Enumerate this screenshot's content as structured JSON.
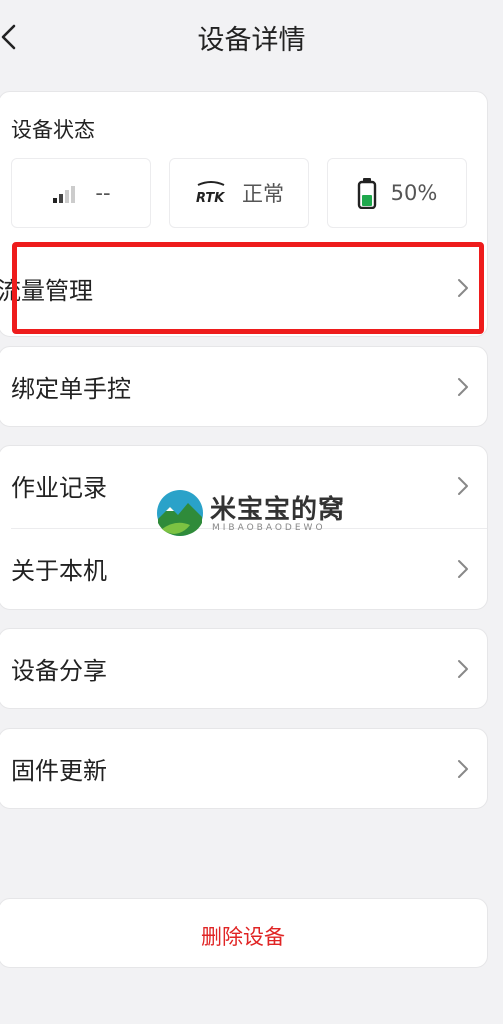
{
  "header": {
    "title": "设备详情"
  },
  "status": {
    "title": "设备状态",
    "signal": {
      "icon": "signal-icon",
      "value": "--"
    },
    "rtk": {
      "icon": "rtk-icon",
      "icon_text": "RTK",
      "value": "正常"
    },
    "battery": {
      "icon": "battery-icon",
      "value": "50%",
      "level": 0.5
    },
    "traffic_label": "流量管理"
  },
  "menu": {
    "bind_controller": "绑定单手控",
    "work_records": "作业记录",
    "about": "关于本机",
    "share": "设备分享",
    "firmware": "固件更新"
  },
  "watermark": {
    "text": "米宝宝的窝",
    "sub": "MIBAOBAODEWO"
  },
  "delete": {
    "label": "删除设备"
  },
  "colors": {
    "danger": "#e02424",
    "highlight": "#ee1c1c",
    "battery_fill": "#1fa84d"
  }
}
